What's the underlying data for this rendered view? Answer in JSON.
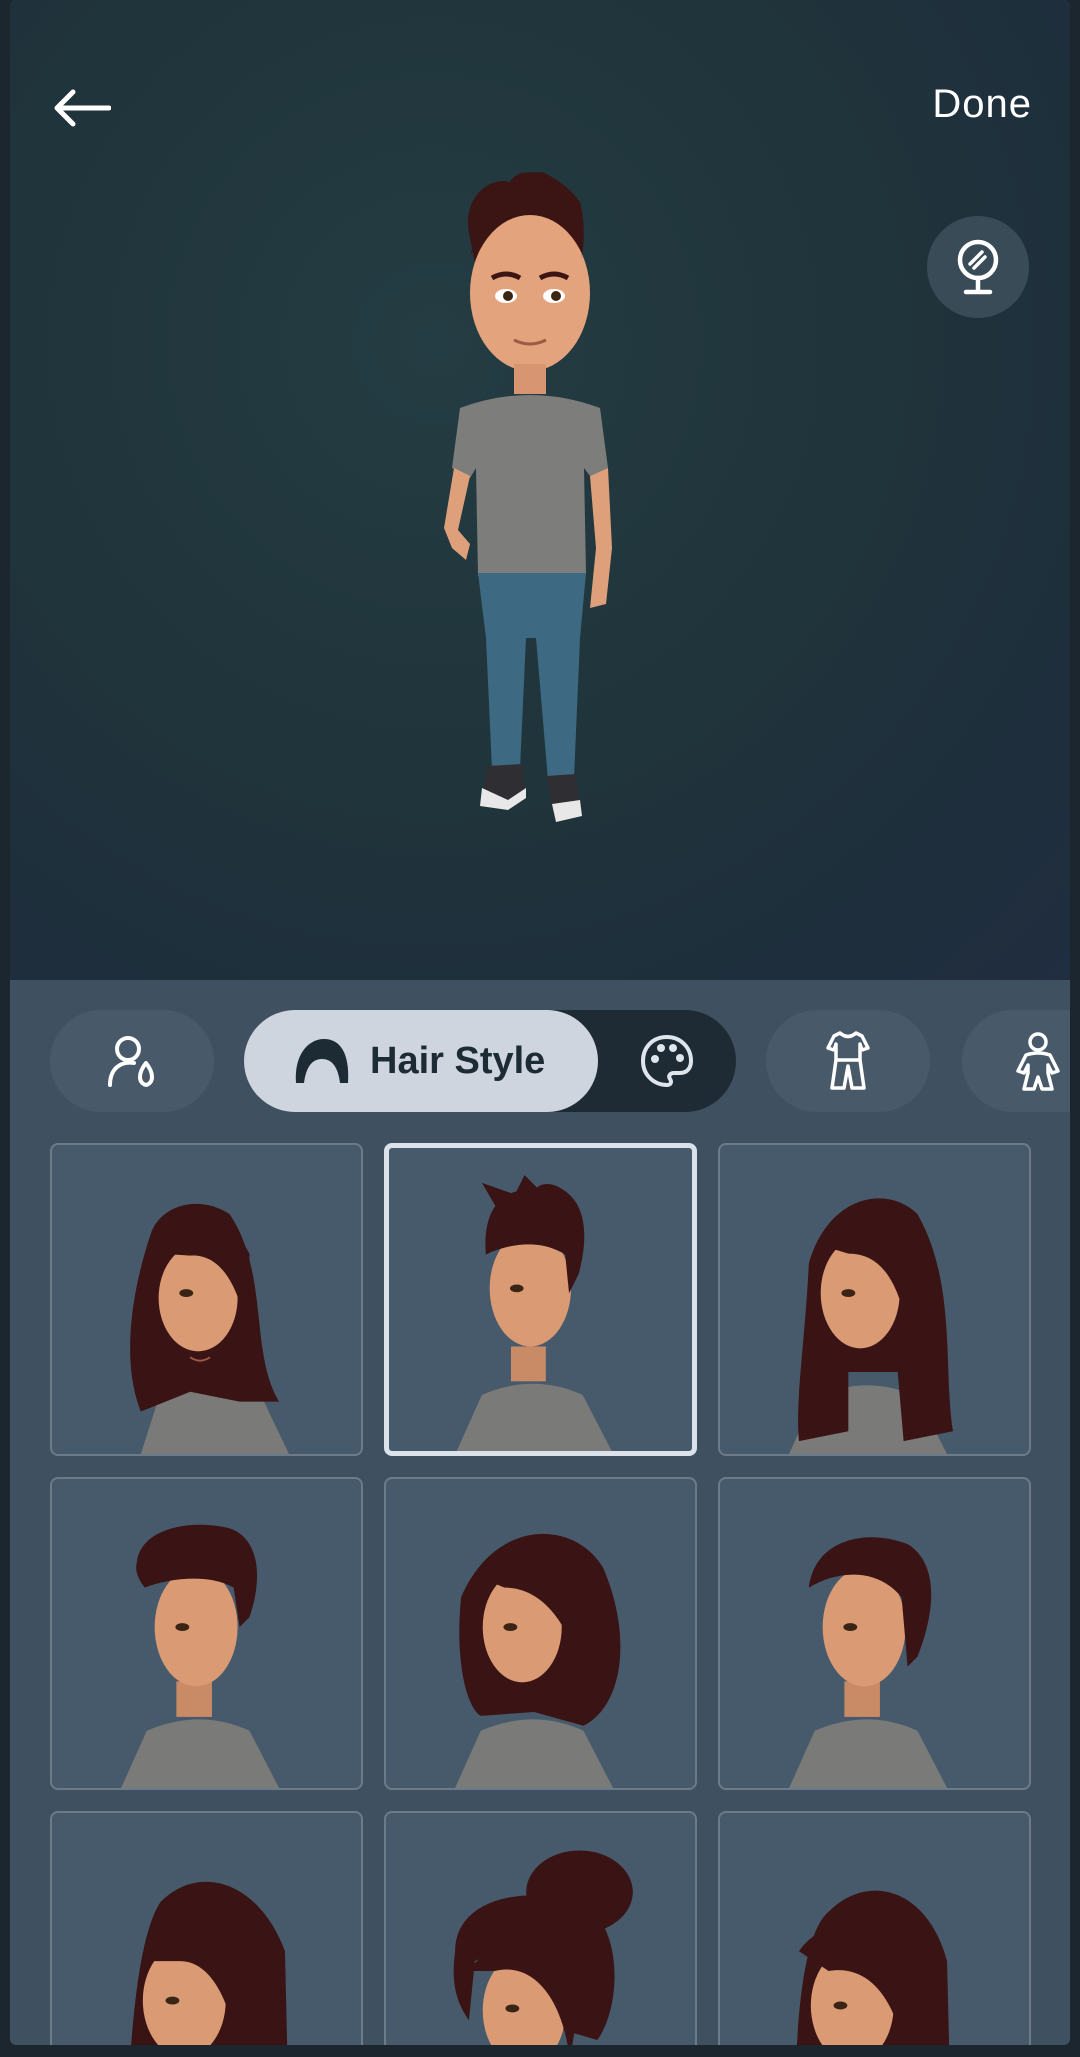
{
  "header": {
    "back_icon": "arrow-left-icon",
    "done_label": "Done",
    "mirror_icon": "mirror-icon"
  },
  "categories": {
    "items": [
      {
        "icon": "face-shape-icon"
      },
      {
        "icon": "hair-icon",
        "label": "Hair Style",
        "active": true
      },
      {
        "icon": "palette-icon"
      },
      {
        "icon": "outfit-icon"
      },
      {
        "icon": "body-icon"
      }
    ]
  },
  "hair_styles": {
    "selected_index": 1,
    "items": [
      {
        "style": "long-wavy"
      },
      {
        "style": "spiky-short"
      },
      {
        "style": "long-straight"
      },
      {
        "style": "pompadour"
      },
      {
        "style": "bob"
      },
      {
        "style": "side-swept-short"
      },
      {
        "style": "long-side-part"
      },
      {
        "style": "messy-bun"
      },
      {
        "style": "long-side-swept"
      }
    ]
  },
  "colors": {
    "active_pill": "#ced5df",
    "inactive_pill": "#48596a",
    "tile_bg": "#475a6c",
    "hair": "#3a1414",
    "skin": "#d99a74"
  }
}
